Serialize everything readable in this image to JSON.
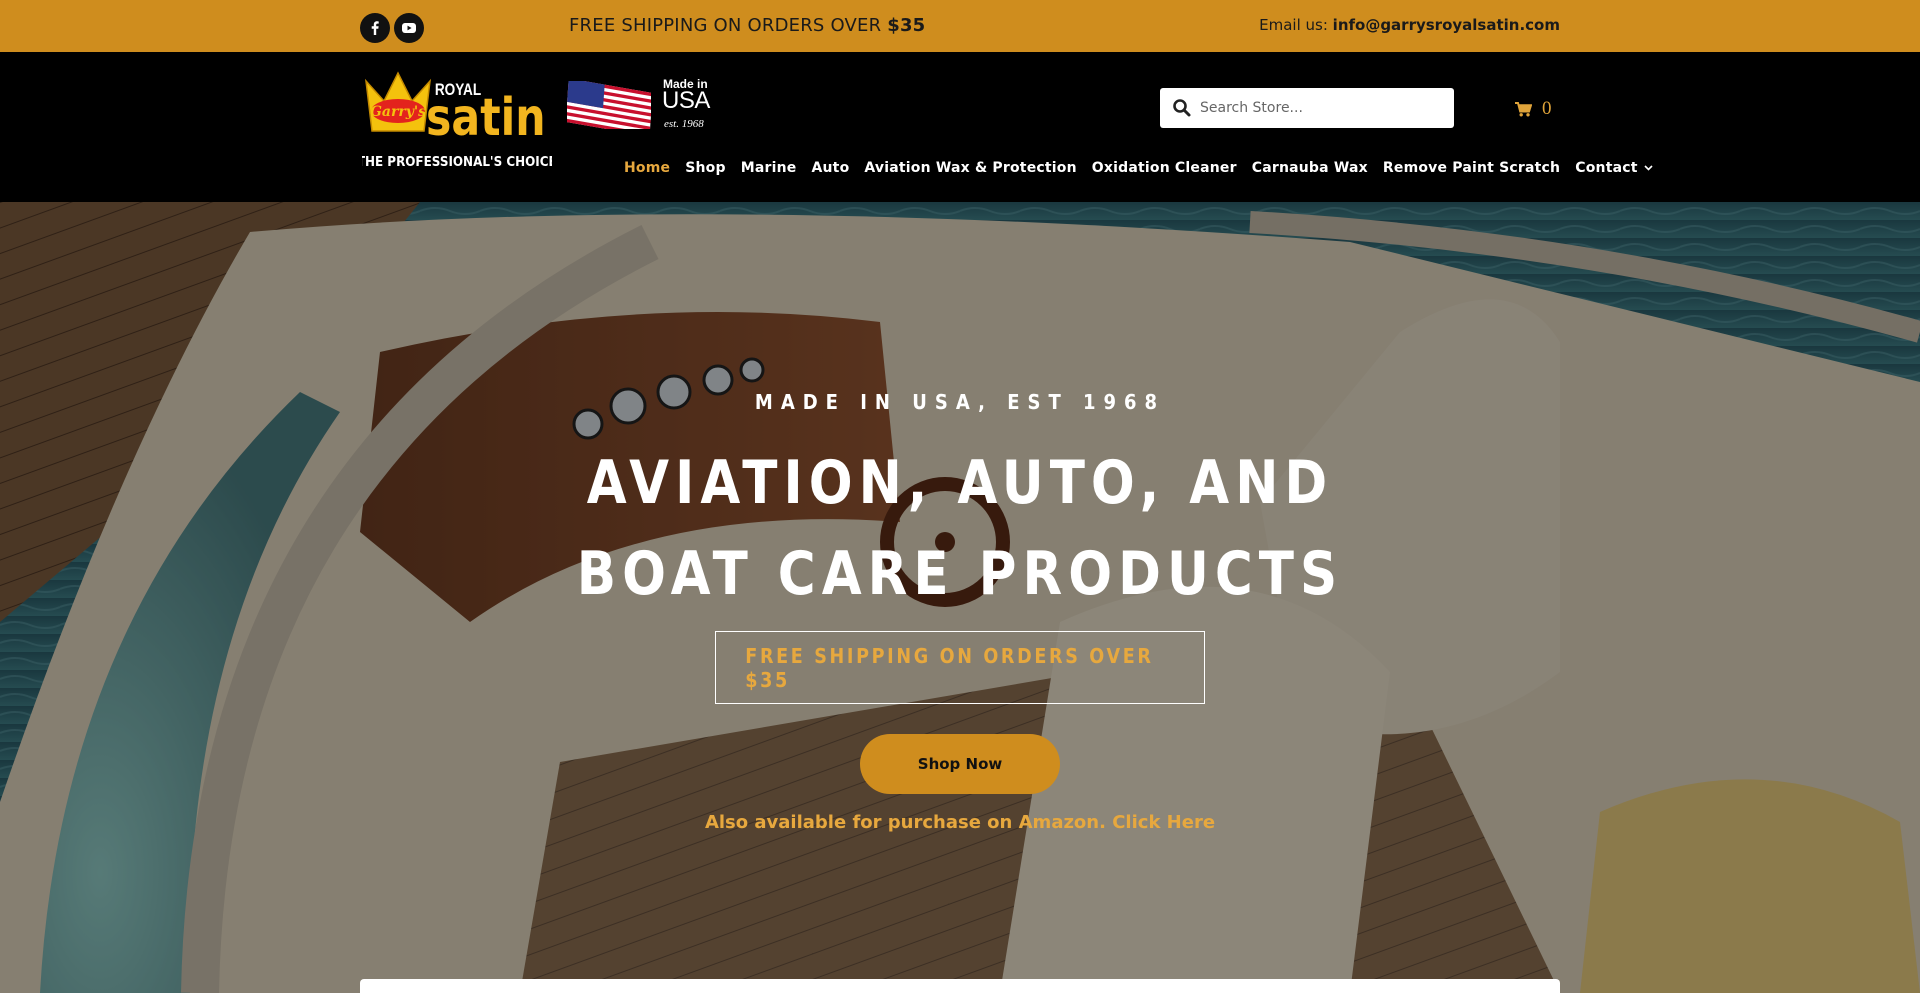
{
  "topbar": {
    "social": [
      {
        "name": "facebook-icon"
      },
      {
        "name": "youtube-icon"
      }
    ],
    "shipping_text": "FREE SHIPPING ON ORDERS OVER",
    "shipping_amount": "$35",
    "email_label": "Email us:",
    "email_address": "info@garrysroyalsatin.com"
  },
  "header": {
    "logo": {
      "top": "Garry's",
      "brand1": "ROYAL",
      "brand2": "satin",
      "tagline": "THE PROFESSIONAL'S CHOICE"
    },
    "made_in": {
      "line1": "Made in",
      "line2": "USA",
      "line3": "est. 1968"
    },
    "search": {
      "placeholder": "Search Store..."
    },
    "cart": {
      "count": "0"
    },
    "nav": [
      {
        "label": "Home",
        "active": true
      },
      {
        "label": "Shop"
      },
      {
        "label": "Marine"
      },
      {
        "label": "Auto"
      },
      {
        "label": "Aviation Wax & Protection"
      },
      {
        "label": "Oxidation Cleaner"
      },
      {
        "label": "Carnauba Wax"
      },
      {
        "label": "Remove Paint Scratch"
      },
      {
        "label": "Contact"
      }
    ]
  },
  "hero": {
    "eyebrow": "MADE IN USA, EST 1968",
    "title": "AVIATION, AUTO, AND BOAT CARE PRODUCTS",
    "shipping_box": "FREE SHIPPING ON ORDERS OVER $35",
    "button": "Shop Now",
    "amazon": "Also available for purchase on Amazon. Click Here"
  },
  "colors": {
    "accent": "#cf8d1e",
    "accent_text": "#e7a83e",
    "header_bg": "#000000"
  }
}
